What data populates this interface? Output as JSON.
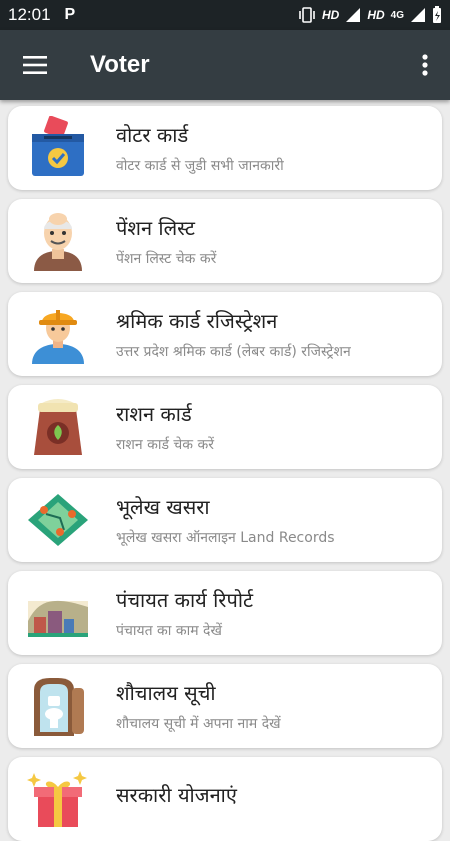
{
  "status_bar": {
    "time": "12:01",
    "app_badge": "P",
    "hd_1": "HD",
    "hd_2": "HD",
    "network": "4G"
  },
  "app_bar": {
    "title": "Voter",
    "menu_icon": "hamburger-menu-icon",
    "overflow_icon": "more-vert-icon"
  },
  "items": [
    {
      "title": "वोटर कार्ड",
      "subtitle": "वोटर कार्ड से जुडी सभी जानकारी",
      "icon": "ballot-box-icon"
    },
    {
      "title": "पेंशन लिस्ट",
      "subtitle": "पेंशन लिस्ट चेक करें",
      "icon": "elderly-man-icon"
    },
    {
      "title": "श्रमिक कार्ड रजिस्ट्रेशन",
      "subtitle": "उत्तर प्रदेश श्रमिक कार्ड (लेबर कार्ड) रजिस्ट्रेशन",
      "icon": "worker-icon"
    },
    {
      "title": "राशन कार्ड",
      "subtitle": "राशन कार्ड चेक करें",
      "icon": "grain-sack-icon"
    },
    {
      "title": "भूलेख खसरा",
      "subtitle": "भूलेख खसरा ऑनलाइन Land Records",
      "icon": "land-map-icon"
    },
    {
      "title": "पंचायत कार्य रिपोर्ट",
      "subtitle": "पंचायत का काम देखें",
      "icon": "village-icon"
    },
    {
      "title": "शौचालय सूची",
      "subtitle": "शौचालय सूची में अपना नाम देखें",
      "icon": "toilet-icon"
    },
    {
      "title": "सरकारी योजनाएं",
      "subtitle": "",
      "icon": "gift-icon"
    }
  ]
}
